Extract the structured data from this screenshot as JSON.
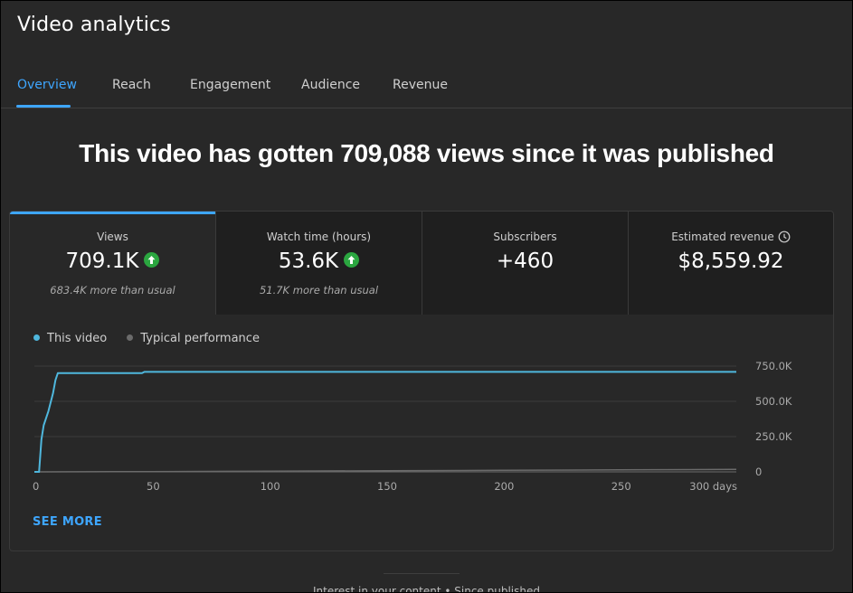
{
  "app": {
    "title": "Video analytics"
  },
  "tabs": [
    {
      "label": "Overview",
      "active": true
    },
    {
      "label": "Reach",
      "active": false
    },
    {
      "label": "Engagement",
      "active": false
    },
    {
      "label": "Audience",
      "active": false
    },
    {
      "label": "Revenue",
      "active": false
    }
  ],
  "headline": "This video has gotten 709,088 views since it was published",
  "metrics": [
    {
      "label": "Views",
      "value": "709.1K",
      "sub": "683.4K more than usual",
      "trend_icon": "arrow-up-circle-icon",
      "active": true
    },
    {
      "label": "Watch time (hours)",
      "value": "53.6K",
      "sub": "51.7K more than usual",
      "trend_icon": "arrow-up-circle-icon",
      "active": false
    },
    {
      "label": "Subscribers",
      "value": "+460",
      "sub": "",
      "active": false
    },
    {
      "label": "Estimated revenue",
      "value": "$8,559.92",
      "sub": "",
      "info_icon": "clock-icon",
      "active": false
    }
  ],
  "legend": {
    "this_video": "This video",
    "typical": "Typical performance"
  },
  "colors": {
    "accent": "#3ea6ff",
    "series_this_video": "#4fb7dd",
    "series_typical": "#6b6b6b",
    "trend_up": "#2ba640"
  },
  "chart_data": {
    "type": "line",
    "xlabel": "",
    "ylabel": "",
    "xlim": [
      0,
      300
    ],
    "ylim": [
      0,
      750000
    ],
    "x_ticks": [
      0,
      50,
      100,
      150,
      200,
      250,
      300
    ],
    "x_tick_labels": [
      "0",
      "50",
      "100",
      "150",
      "200",
      "250",
      "300 days"
    ],
    "y_ticks": [
      0,
      250000,
      500000,
      750000
    ],
    "y_tick_labels": [
      "0",
      "250.0K",
      "500.0K",
      "750.0K"
    ],
    "grid": true,
    "legend_position": "top-left",
    "series": [
      {
        "name": "This video",
        "x": [
          0,
          2,
          3,
          4,
          6,
          8,
          9,
          10,
          12,
          46,
          47,
          300
        ],
        "y": [
          0,
          0,
          230000,
          330000,
          430000,
          560000,
          650000,
          700000,
          700000,
          700000,
          709000,
          709088
        ]
      },
      {
        "name": "Typical performance",
        "x": [
          0,
          50,
          100,
          150,
          200,
          250,
          300
        ],
        "y": [
          0,
          2000,
          5000,
          8000,
          11000,
          14000,
          17000
        ]
      }
    ]
  },
  "see_more": "SEE MORE",
  "footer": "Interest in your content • Since published"
}
